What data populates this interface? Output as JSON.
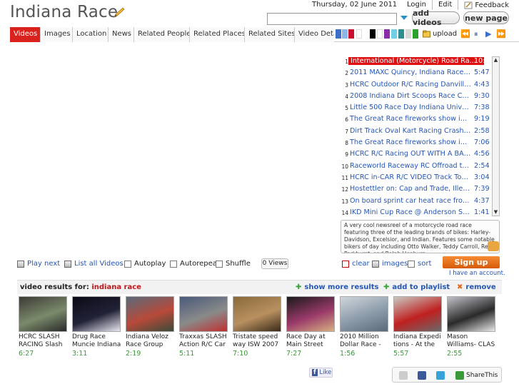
{
  "header": {
    "title": "Indiana Race",
    "date": "Thursday, 02 June 2011",
    "links": [
      "Login",
      "Edit",
      "Feedback"
    ],
    "search_value": "",
    "add_videos": "add videos",
    "new_page": "new page"
  },
  "tabs": [
    "Videos",
    "Images",
    "Location",
    "News",
    "Related People",
    "Related Places",
    "Related Sites",
    "Video Deta"
  ],
  "swatches": [
    "#3b6fc7",
    "#8db6e8",
    "#c8102e",
    "#ffffff",
    "#000000",
    "#ffffff",
    "#8a2ca8",
    "#6fd0e6",
    "#2c8f8f",
    "#d8d8d8",
    "#2ca12c"
  ],
  "upload_label": "upload",
  "playlist": [
    {
      "n": "1",
      "title": "International (Motorcycle) Road Ra...",
      "dur": "10:28"
    },
    {
      "n": "2",
      "title": "2011 MAXC Quincy, Indiana Race R...",
      "dur": "5:47"
    },
    {
      "n": "3",
      "title": "HCRC Outdoor R/C Racing Danville I...",
      "dur": "4:43"
    },
    {
      "n": "4",
      "title": "2008 Indiana Dirt Scoops Race Cau...",
      "dur": "9:30"
    },
    {
      "n": "5",
      "title": "Little 500 Race Day Indiana Univer...",
      "dur": "7:38"
    },
    {
      "n": "6",
      "title": "The Great Race fireworks show in (...",
      "dur": "9:19"
    },
    {
      "n": "7",
      "title": "Dirt Track Oval Kart Racing Crash - ...",
      "dur": "2:58"
    },
    {
      "n": "8",
      "title": "The Great Race fireworks show in (...",
      "dur": "7:06"
    },
    {
      "n": "9",
      "title": "HCRC R/C Racing OUT WITH A BANG...",
      "dur": "4:56"
    },
    {
      "n": "10",
      "title": "Raceworld Raceway RC Offroad tra...",
      "dur": "2:54"
    },
    {
      "n": "11",
      "title": "HCRC in-CAR R/C VIDEO Track Tour! ...",
      "dur": "3:04"
    },
    {
      "n": "12",
      "title": "Hostettler on: Cap and Trade, Illeg...",
      "dur": "7:39"
    },
    {
      "n": "13",
      "title": "On board sprint car heat race fron...",
      "dur": "4:37"
    },
    {
      "n": "14",
      "title": "IKD Mini Cup Race @ Anderson Spe...",
      "dur": "1:41"
    }
  ],
  "description": "A very cool newsreel of a motorcycle road race featuring three of the leading brands of bikes: Harley-Davidson, Excelsior, and Indian. Features some notable bikers of day including Otto Walker, Teddy Carroll, Red Parkhurst, and Ralph Hepburn.",
  "controls": {
    "play_next": "Play next",
    "list_all": "List all Videos",
    "autoplay": "Autoplay",
    "autorepeat": "Autorepeat",
    "shuffle": "Shuffle",
    "views": "0 Views",
    "clear": "clear",
    "images": "images",
    "sort": "sort",
    "signup": "Sign up",
    "account": "I have an account."
  },
  "results": {
    "label": "video results for:",
    "query": "indiana race",
    "show_more": "show more results",
    "add_playlist": "add to playlist",
    "remove": "remove"
  },
  "thumbs": [
    {
      "title": "HCRC SLASH RACING Slash",
      "dur": "6:27",
      "colors": [
        "#3d3a36",
        "#7a8a6a",
        "#2a2a2a"
      ]
    },
    {
      "title": "Drug Race Muncie Indiana",
      "dur": "3:11",
      "colors": [
        "#0b0b14",
        "#222238",
        "#e8e8f0"
      ]
    },
    {
      "title": "Indiana Veloz Race Group",
      "dur": "2:19",
      "colors": [
        "#5a6b7a",
        "#b84a3a",
        "#3a4a3a"
      ]
    },
    {
      "title": "Traxxas SLASH Action R/C Car",
      "dur": "5:11",
      "colors": [
        "#4a5a7a",
        "#8a8a8a",
        "#c03030"
      ]
    },
    {
      "title": "Tristate speed way ISW 2007",
      "dur": "7:10",
      "colors": [
        "#8a6a3a",
        "#b89060",
        "#3a2a1a"
      ]
    },
    {
      "title": "Race Day at Main Street",
      "dur": "7:27",
      "colors": [
        "#1a1a1a",
        "#9a3a6a",
        "#d8b080"
      ]
    },
    {
      "title": "2010 Million Dollar Race -",
      "dur": "1:56",
      "colors": [
        "#cfd5da",
        "#8a9aa8",
        "#5a6a7a"
      ]
    },
    {
      "title": "Indiana Expedi tions - At the",
      "dur": "5:57",
      "colors": [
        "#c8c8c0",
        "#c02020",
        "#6a6a6a"
      ]
    },
    {
      "title": "Mason Williams- CLAS",
      "dur": "2:55",
      "colors": [
        "#c0c0c8",
        "#2a2a2a",
        "#e8e8e8"
      ]
    }
  ],
  "footer": {
    "like": "Like",
    "sharethis": "ShareThis"
  }
}
